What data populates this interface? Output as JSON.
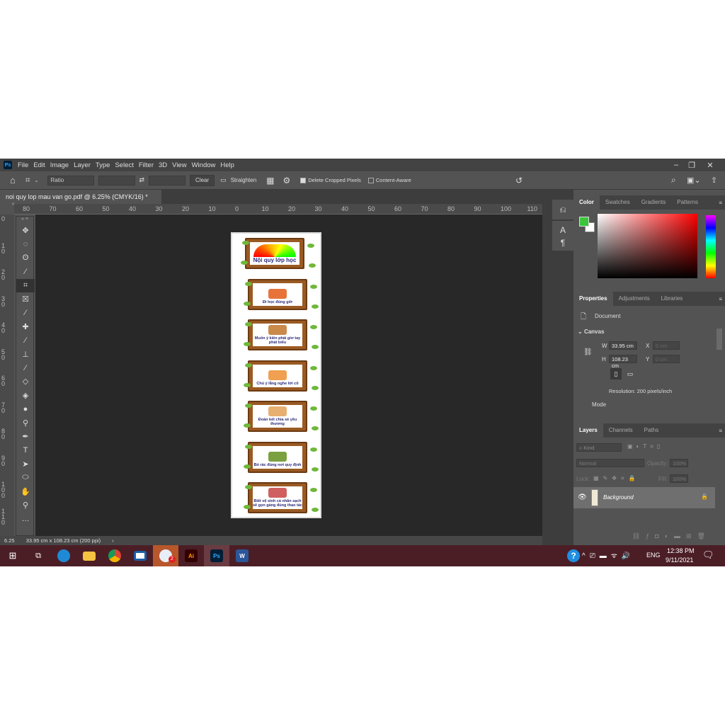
{
  "app": {
    "logo": "Ps",
    "menus": [
      "File",
      "Edit",
      "Image",
      "Layer",
      "Type",
      "Select",
      "Filter",
      "3D",
      "View",
      "Window",
      "Help"
    ]
  },
  "options": {
    "ratio": "Ratio",
    "clear": "Clear",
    "straighten": "Straighten",
    "delete_cropped": "Delete Cropped Pixels",
    "delete_cropped_checked": true,
    "content_aware": "Content-Aware",
    "content_aware_checked": false
  },
  "document_tab": {
    "title": "noi quy lop mau van go.pdf @ 6.25% (CMYK/16) *",
    "close": "×"
  },
  "ruler_top": [
    "80",
    "70",
    "60",
    "50",
    "40",
    "30",
    "20",
    "10",
    "0",
    "10",
    "20",
    "30",
    "40",
    "50",
    "60",
    "70",
    "80",
    "90",
    "100",
    "110"
  ],
  "ruler_left": [
    "0",
    "10",
    "20",
    "30",
    "40",
    "50",
    "60",
    "70",
    "80",
    "90",
    "100",
    "110"
  ],
  "document": {
    "title": "Nội quy lớp học",
    "boards": [
      "Đi học đúng giờ",
      "Muốn ý kiến phải giơ tay phát biểu",
      "Chú ý lắng nghe lời cô",
      "Đoàn kết chia sẻ yêu thương",
      "Bỏ rác đúng nơi quy định",
      "Biết vệ sinh cá nhân sạch sẽ gọn gàng đúng thao tác"
    ]
  },
  "status": {
    "zoom": "6.25",
    "info": "33.95 cm x 108.23 cm (200 ppi)",
    "arrow": "›"
  },
  "color_panel": {
    "tabs": [
      "Color",
      "Swatches",
      "Gradients",
      "Patterns"
    ],
    "foreground": "#3cc43c",
    "background": "#ffffff",
    "hue": "#ff0000"
  },
  "properties": {
    "tabs": [
      "Properties",
      "Adjustments",
      "Libraries"
    ],
    "document_label": "Document",
    "canvas_label": "Canvas",
    "w_label": "W",
    "w": "33.95 cm",
    "h_label": "H",
    "h": "108.23 cm",
    "x_label": "X",
    "x": "0 cm",
    "y_label": "Y",
    "y": "0 cm",
    "resolution": "Resolution: 200 pixels/inch",
    "mode": "Mode"
  },
  "layers": {
    "tabs": [
      "Layers",
      "Channels",
      "Paths"
    ],
    "kind": "Kind",
    "blend": "Normal",
    "opacity_label": "Opacity:",
    "opacity": "100%",
    "lock_label": "Lock:",
    "fill_label": "Fill:",
    "fill": "100%",
    "items": [
      {
        "name": "Background",
        "visible": true,
        "locked": true
      }
    ]
  },
  "taskbar": {
    "time": "12:38 PM",
    "date": "9/11/2021",
    "lang": "ENG",
    "badge": "2",
    "apps": [
      "windows",
      "task-view",
      "edge",
      "file-explorer",
      "chrome",
      "app",
      "zalo",
      "illustrator",
      "photoshop",
      "word"
    ]
  }
}
